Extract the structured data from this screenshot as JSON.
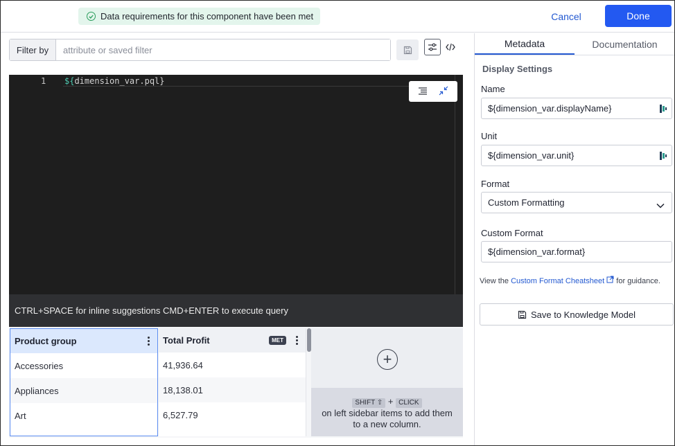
{
  "header": {
    "status_text": "Data requirements for this component have been met",
    "cancel_label": "Cancel",
    "done_label": "Done"
  },
  "filter": {
    "label": "Filter by",
    "placeholder": "attribute or saved filter"
  },
  "editor": {
    "line_number": "1",
    "code_open": "${",
    "code_rest": "dimension_var.pql}",
    "hint": "CTRL+SPACE for inline suggestions CMD+ENTER to execute query"
  },
  "table": {
    "columns": [
      {
        "name": "Product group"
      },
      {
        "name": "Total Profit",
        "badge": "MET"
      }
    ],
    "rows": [
      [
        "Accessories",
        "41,936.64"
      ],
      [
        "Appliances",
        "18,138.01"
      ],
      [
        "Art",
        "6,527.79"
      ]
    ],
    "add_column": {
      "key1": "SHIFT ⇧",
      "plus": "+",
      "key2": "CLICK",
      "hint_line1": "on left sidebar items to add them",
      "hint_line2": "to a new column."
    }
  },
  "panel": {
    "tabs": [
      {
        "label": "Metadata",
        "active": true
      },
      {
        "label": "Documentation",
        "active": false
      }
    ],
    "section_title": "Display Settings",
    "name": {
      "label": "Name",
      "value": "${dimension_var.displayName}"
    },
    "unit": {
      "label": "Unit",
      "value": "${dimension_var.unit}"
    },
    "format": {
      "label": "Format",
      "value": "Custom Formatting"
    },
    "custom_format": {
      "label": "Custom Format",
      "value": "${dimension_var.format}"
    },
    "help": {
      "prefix": "View the ",
      "link": "Custom Format Cheatsheet",
      "suffix": " for guidance."
    },
    "save_label": "Save to Knowledge Model"
  },
  "colors": {
    "accent": "#2359f1",
    "success": "#2a9d5c",
    "editor_bg": "#1e1e1e"
  }
}
